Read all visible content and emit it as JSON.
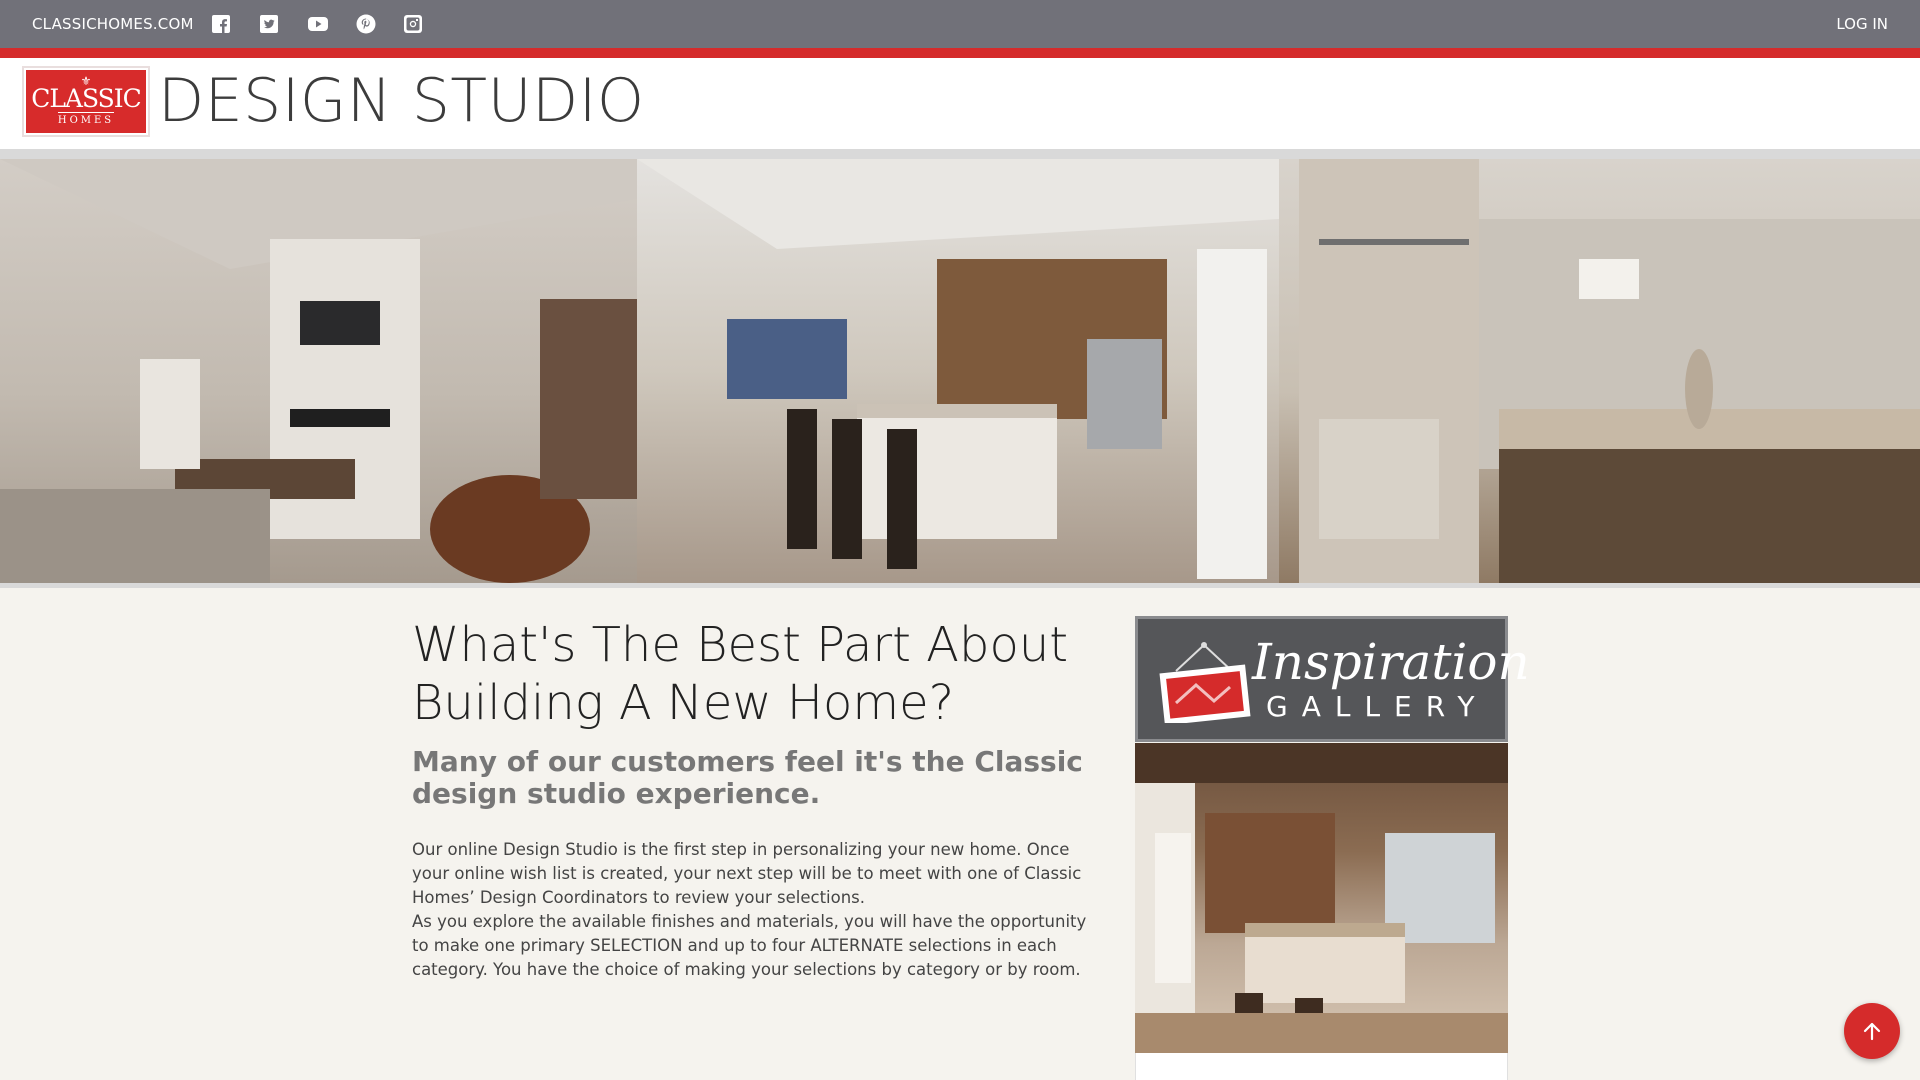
{
  "topbar": {
    "site_link": "CLASSICHOMES.COM",
    "login": "LOG IN",
    "social_icons": [
      "facebook-icon",
      "twitter-icon",
      "youtube-icon",
      "pinterest-icon",
      "instagram-icon"
    ]
  },
  "header": {
    "logo_word1": "CLASSIC",
    "logo_word2": "HOMES",
    "title": "DESIGN STUDIO"
  },
  "main": {
    "headline": "What's The Best Part About Building A New Home?",
    "subhead": "Many of our customers feel it's the Classic design studio experience.",
    "paragraph1": "Our online Design Studio is the first step in personalizing your new home. Once your online wish list is created, your next step will be to meet with one of Classic Homes’ Design Coordinators to review your selections.",
    "paragraph2": "As you explore the available finishes and materials, you will have the opportunity to make one primary SELECTION and up to four ALTERNATE selections in each category. You have the choice of making your selections by category or by room."
  },
  "sidebar": {
    "gallery_title": "Inspiration",
    "gallery_subtitle": "GALLERY"
  },
  "colors": {
    "topbar": "#717179",
    "accent_red": "#d52b2b",
    "background": "#f5f3ee"
  }
}
